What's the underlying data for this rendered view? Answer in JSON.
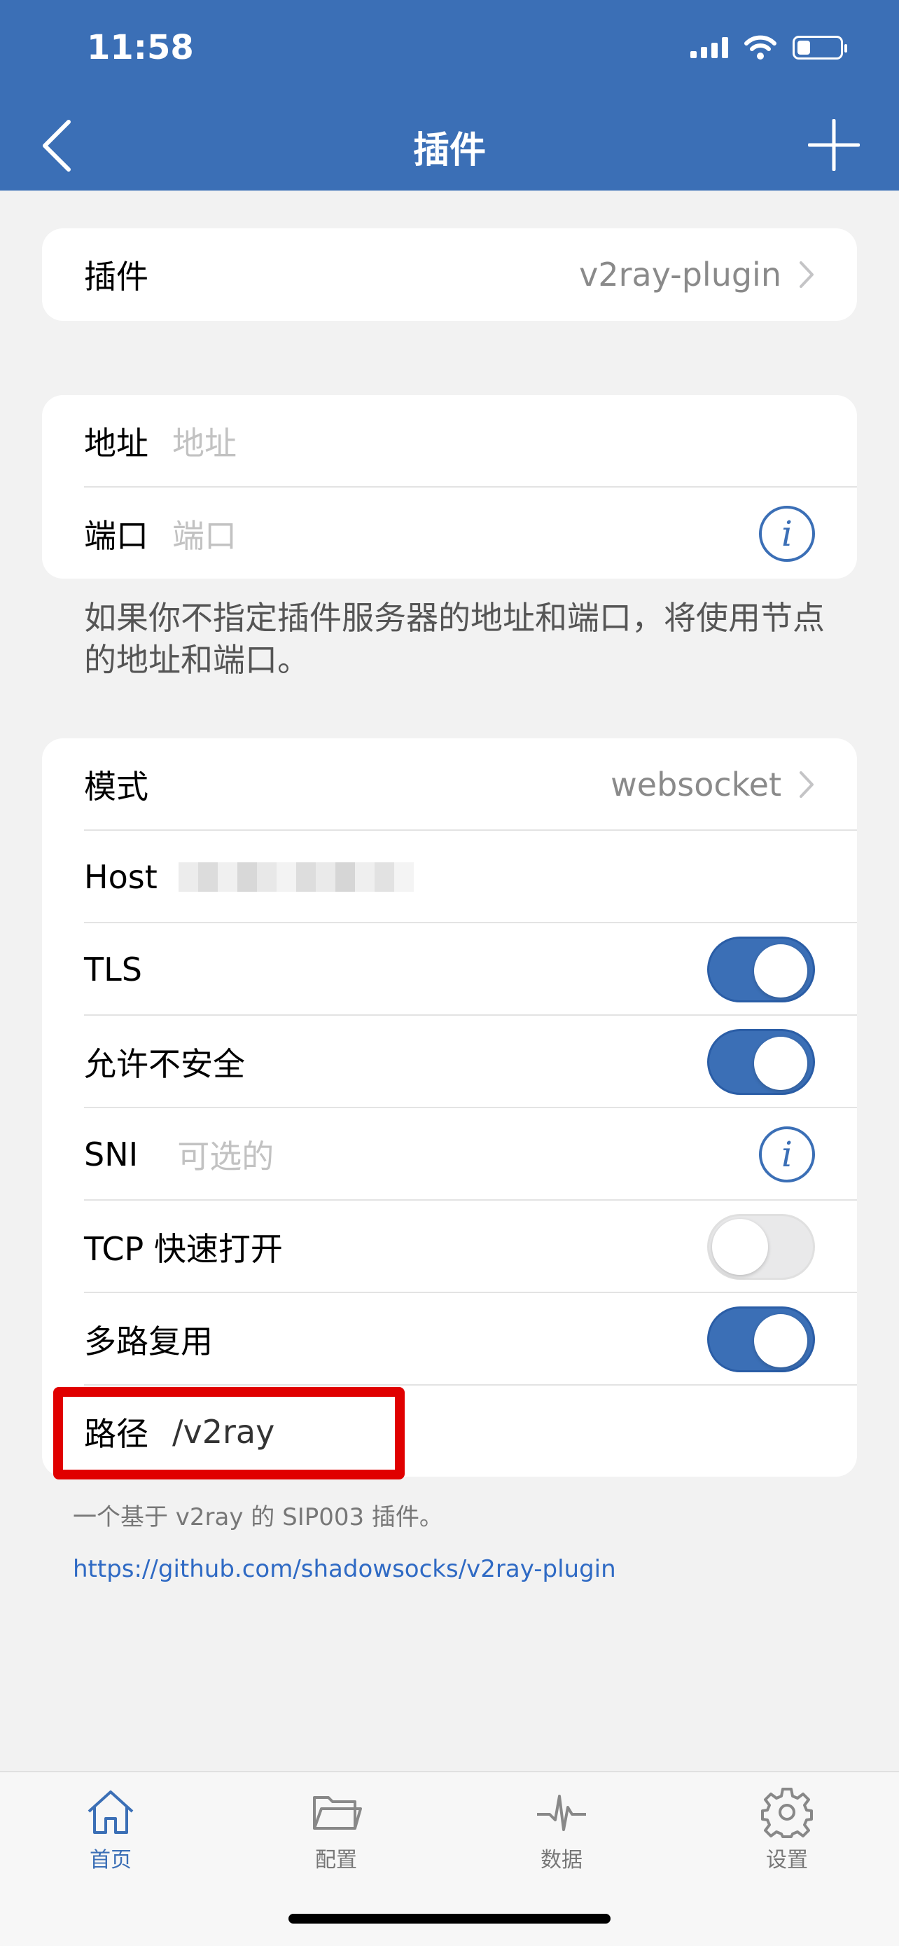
{
  "status": {
    "time": "11:58"
  },
  "nav": {
    "title": "插件"
  },
  "plugin_card": {
    "label": "插件",
    "value": "v2ray-plugin"
  },
  "server_card": {
    "address_label": "地址",
    "address_placeholder": "地址",
    "port_label": "端口",
    "port_placeholder": "端口"
  },
  "note": "如果你不指定插件服务器的地址和端口，将使用节点的地址和端口。",
  "options": {
    "mode_label": "模式",
    "mode_value": "websocket",
    "host_label": "Host",
    "tls_label": "TLS",
    "tls_on": true,
    "insecure_label": "允许不安全",
    "insecure_on": true,
    "sni_label": "SNI",
    "sni_placeholder": "可选的",
    "tcp_fast_open_label": "TCP 快速打开",
    "tcp_fast_open_on": false,
    "mux_label": "多路复用",
    "mux_on": true,
    "path_label": "路径",
    "path_value": "/v2ray"
  },
  "footer": {
    "description": "一个基于 v2ray 的 SIP003 插件。",
    "link": "https://github.com/shadowsocks/v2ray-plugin"
  },
  "tabs": [
    {
      "label": "首页",
      "icon": "home-icon",
      "active": true
    },
    {
      "label": "配置",
      "icon": "folder-icon",
      "active": false
    },
    {
      "label": "数据",
      "icon": "pulse-icon",
      "active": false
    },
    {
      "label": "设置",
      "icon": "gear-icon",
      "active": false
    }
  ],
  "colors": {
    "accent": "#3b6fb6",
    "highlight": "#e00000",
    "link": "#2f6ac4"
  }
}
